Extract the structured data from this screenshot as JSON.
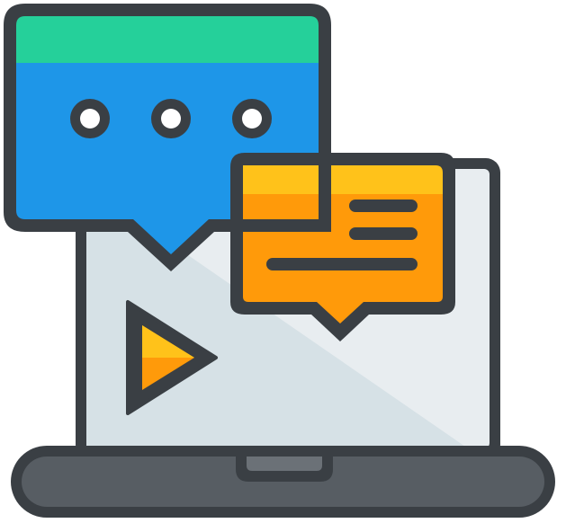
{
  "illustration": {
    "subject": "laptop-video-chat-icon",
    "colors": {
      "outline": "#3a3f44",
      "laptop_screen_light": "#e8edf0",
      "laptop_screen_shade": "#d6e1e6",
      "laptop_base": "#575d63",
      "laptop_base_highlight": "#6b7177",
      "chat_bubble_header": "#25d09a",
      "chat_bubble_body": "#1e96e8",
      "chat_dot": "#ffffff",
      "message_bubble_top": "#ffc21a",
      "message_bubble_body": "#ff9a0a",
      "play_button_top": "#ffc21a",
      "play_button_body": "#ff9a0a"
    },
    "icons": [
      "laptop-icon",
      "chat-bubble-icon",
      "typing-dots-icon",
      "message-bubble-icon",
      "play-button-icon"
    ]
  }
}
